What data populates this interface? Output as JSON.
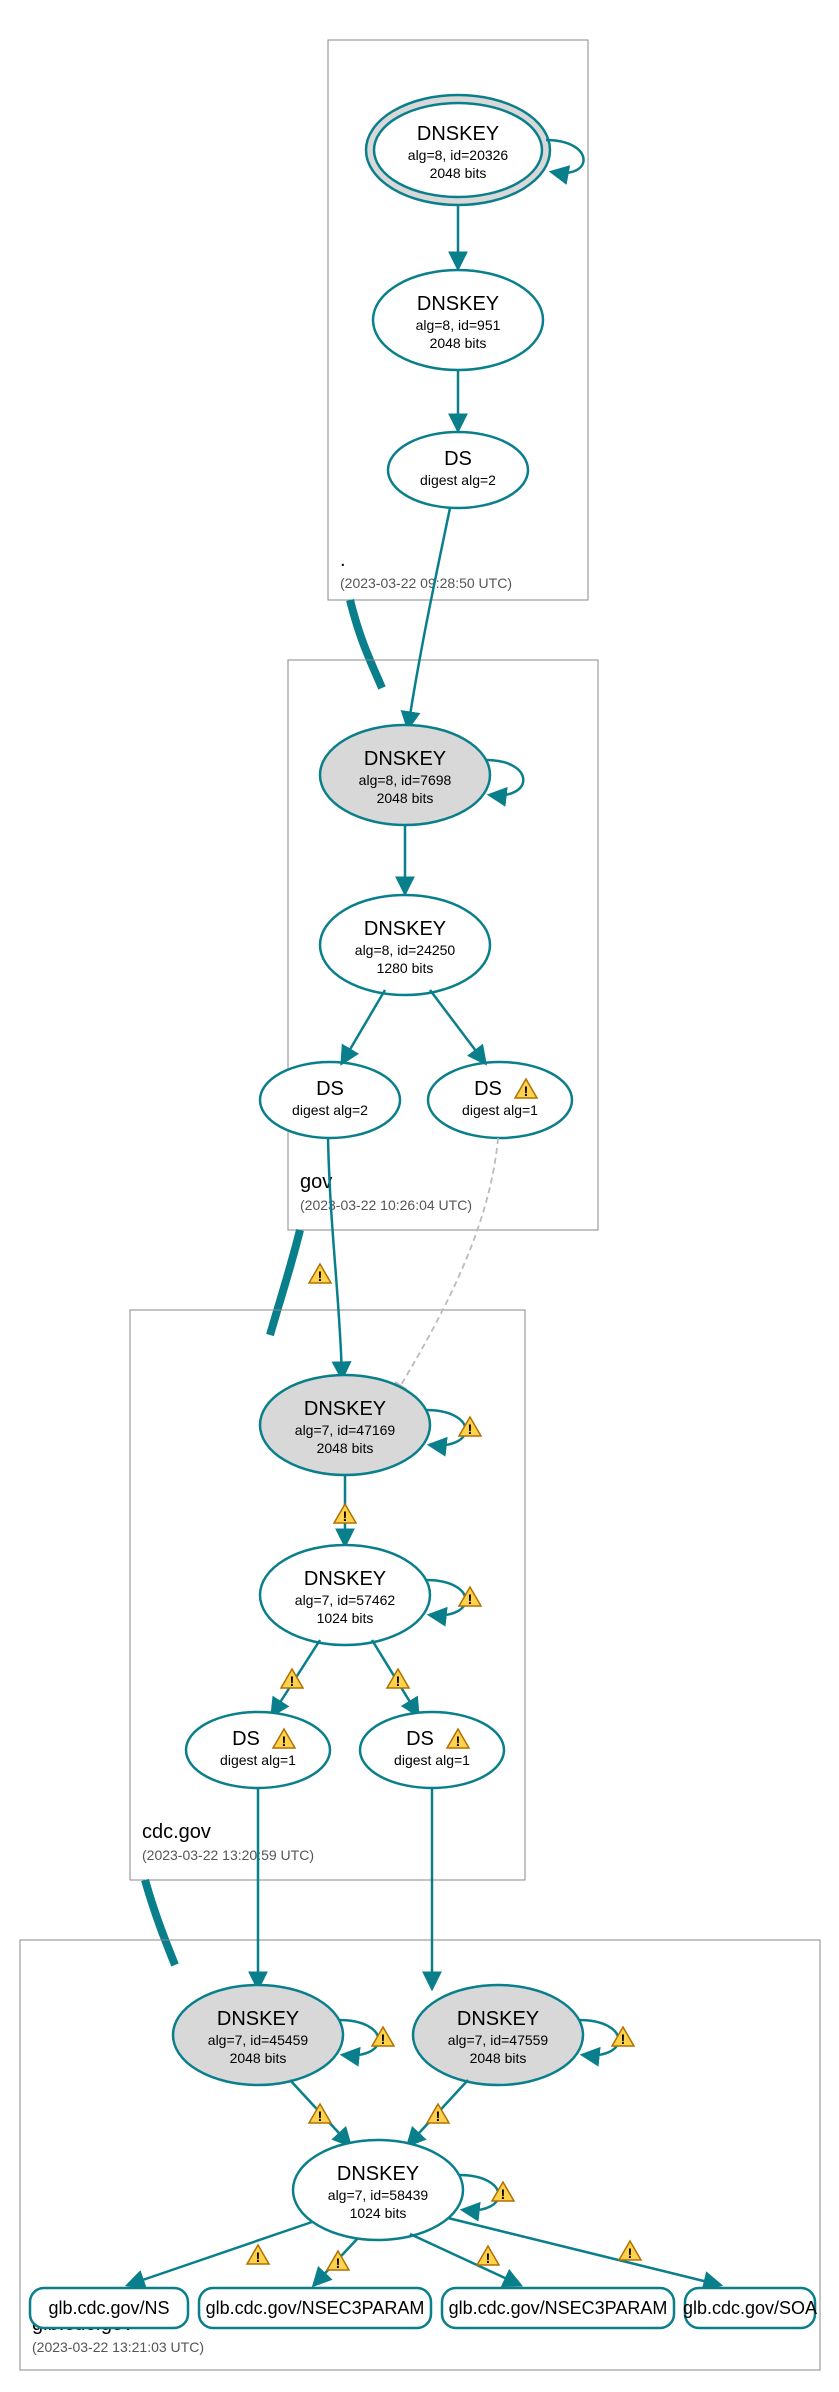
{
  "zones": {
    "root": {
      "label": ".",
      "timestamp": "(2023-03-22 09:28:50 UTC)"
    },
    "gov": {
      "label": "gov",
      "timestamp": "(2023-03-22 10:26:04 UTC)"
    },
    "cdc": {
      "label": "cdc.gov",
      "timestamp": "(2023-03-22 13:20:59 UTC)"
    },
    "glb": {
      "label": "glb.cdc.gov",
      "timestamp": "(2023-03-22 13:21:03 UTC)"
    }
  },
  "nodes": {
    "root_ksk": {
      "title": "DNSKEY",
      "line2": "alg=8, id=20326",
      "line3": "2048 bits"
    },
    "root_zsk": {
      "title": "DNSKEY",
      "line2": "alg=8, id=951",
      "line3": "2048 bits"
    },
    "root_ds": {
      "title": "DS",
      "line2": "digest alg=2"
    },
    "gov_ksk": {
      "title": "DNSKEY",
      "line2": "alg=8, id=7698",
      "line3": "2048 bits"
    },
    "gov_zsk": {
      "title": "DNSKEY",
      "line2": "alg=8, id=24250",
      "line3": "1280 bits"
    },
    "gov_ds1": {
      "title": "DS",
      "line2": "digest alg=2"
    },
    "gov_ds2": {
      "title": "DS",
      "line2": "digest alg=1"
    },
    "cdc_ksk": {
      "title": "DNSKEY",
      "line2": "alg=7, id=47169",
      "line3": "2048 bits"
    },
    "cdc_zsk": {
      "title": "DNSKEY",
      "line2": "alg=7, id=57462",
      "line3": "1024 bits"
    },
    "cdc_ds1": {
      "title": "DS",
      "line2": "digest alg=1"
    },
    "cdc_ds2": {
      "title": "DS",
      "line2": "digest alg=1"
    },
    "glb_ksk1": {
      "title": "DNSKEY",
      "line2": "alg=7, id=45459",
      "line3": "2048 bits"
    },
    "glb_ksk2": {
      "title": "DNSKEY",
      "line2": "alg=7, id=47559",
      "line3": "2048 bits"
    },
    "glb_zsk": {
      "title": "DNSKEY",
      "line2": "alg=7, id=58439",
      "line3": "1024 bits"
    }
  },
  "rr": {
    "ns": "glb.cdc.gov/NS",
    "nsec3a": "glb.cdc.gov/NSEC3PARAM",
    "nsec3b": "glb.cdc.gov/NSEC3PARAM",
    "soa": "glb.cdc.gov/SOA"
  },
  "chart_data": {
    "type": "diagram",
    "description": "DNSSEC delegation / signature graph (DNSViz-style) for glb.cdc.gov",
    "zones": [
      {
        "name": ".",
        "analyzed_at": "2023-03-22 09:28:50 UTC"
      },
      {
        "name": "gov",
        "analyzed_at": "2023-03-22 10:26:04 UTC"
      },
      {
        "name": "cdc.gov",
        "analyzed_at": "2023-03-22 13:20:59 UTC"
      },
      {
        "name": "glb.cdc.gov",
        "analyzed_at": "2023-03-22 13:21:03 UTC"
      }
    ],
    "keys": [
      {
        "zone": ".",
        "role": "KSK",
        "alg": 8,
        "id": 20326,
        "bits": 2048,
        "trust_anchor": true
      },
      {
        "zone": ".",
        "role": "ZSK",
        "alg": 8,
        "id": 951,
        "bits": 2048
      },
      {
        "zone": "gov",
        "role": "KSK",
        "alg": 8,
        "id": 7698,
        "bits": 2048
      },
      {
        "zone": "gov",
        "role": "ZSK",
        "alg": 8,
        "id": 24250,
        "bits": 1280
      },
      {
        "zone": "cdc.gov",
        "role": "KSK",
        "alg": 7,
        "id": 47169,
        "bits": 2048,
        "warnings": true
      },
      {
        "zone": "cdc.gov",
        "role": "ZSK",
        "alg": 7,
        "id": 57462,
        "bits": 1024,
        "warnings": true
      },
      {
        "zone": "glb.cdc.gov",
        "role": "KSK",
        "alg": 7,
        "id": 45459,
        "bits": 2048,
        "warnings": true
      },
      {
        "zone": "glb.cdc.gov",
        "role": "KSK",
        "alg": 7,
        "id": 47559,
        "bits": 2048,
        "warnings": true
      },
      {
        "zone": "glb.cdc.gov",
        "role": "ZSK",
        "alg": 7,
        "id": 58439,
        "bits": 1024,
        "warnings": true
      }
    ],
    "ds_records": [
      {
        "in_zone": ".",
        "for": "gov",
        "digest_alg": 2
      },
      {
        "in_zone": "gov",
        "for": "cdc.gov",
        "digest_alg": 2
      },
      {
        "in_zone": "gov",
        "for": "cdc.gov",
        "digest_alg": 1,
        "warnings": true
      },
      {
        "in_zone": "cdc.gov",
        "for": "glb.cdc.gov",
        "digest_alg": 1,
        "warnings": true
      },
      {
        "in_zone": "cdc.gov",
        "for": "glb.cdc.gov",
        "digest_alg": 1,
        "warnings": true
      }
    ],
    "rrsets_signed": [
      "glb.cdc.gov/NS",
      "glb.cdc.gov/NSEC3PARAM",
      "glb.cdc.gov/NSEC3PARAM",
      "glb.cdc.gov/SOA"
    ]
  }
}
